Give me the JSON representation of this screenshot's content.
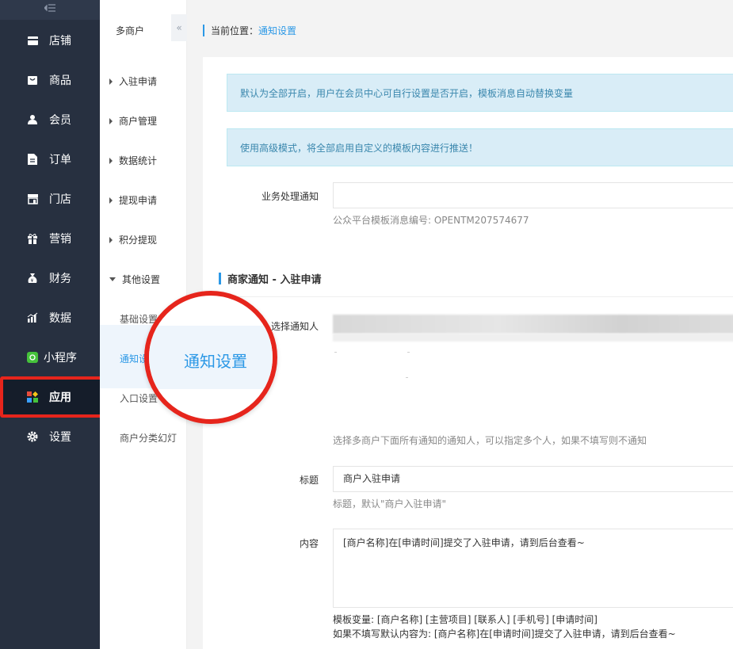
{
  "sidebar": {
    "collapse_icon": "menu-collapse-icon",
    "items": [
      {
        "label": "店铺",
        "icon": "store-icon"
      },
      {
        "label": "商品",
        "icon": "bag-icon"
      },
      {
        "label": "会员",
        "icon": "user-icon"
      },
      {
        "label": "订单",
        "icon": "document-icon"
      },
      {
        "label": "门店",
        "icon": "shop-icon"
      },
      {
        "label": "营销",
        "icon": "gift-icon"
      },
      {
        "label": "财务",
        "icon": "money-bag-icon"
      },
      {
        "label": "数据",
        "icon": "bar-chart-icon"
      },
      {
        "label": "小程序",
        "icon": "mini-program-icon"
      },
      {
        "label": "应用",
        "icon": "apps-icon"
      },
      {
        "label": "设置",
        "icon": "gear-icon"
      }
    ],
    "active": "应用"
  },
  "submenu": {
    "title": "多商户",
    "collapse": "«",
    "groups": [
      {
        "label": "入驻申请"
      },
      {
        "label": "商户管理"
      },
      {
        "label": "数据统计"
      },
      {
        "label": "提现申请"
      },
      {
        "label": "积分提现"
      },
      {
        "label": "其他设置"
      }
    ],
    "children": [
      {
        "label": "基础设置"
      },
      {
        "label": "通知设"
      },
      {
        "label": "入口设置"
      },
      {
        "label": "商户分类幻灯"
      }
    ]
  },
  "breadcrumb": {
    "prefix": "当前位置：",
    "current": "通知设置"
  },
  "notices": [
    "默认为全部开启，用户在会员中心可自行设置是否开启，模板消息自动替换变量",
    "使用高级模式，将全部启用自定义的模板内容进行推送！"
  ],
  "form": {
    "business_label": "业务处理通知",
    "business_value": "",
    "business_hint": "公众平台模板消息编号: OPENTM207574677",
    "section_title": "商家通知 - 入驻申请",
    "notify_label": "选择通知人",
    "notify_hint": "选择多商户下面所有通知的通知人，可以指定多个人，如果不填写则不通知",
    "title_label": "标题",
    "title_value": "商户入驻申请",
    "title_hint": "标题，默认\"商户入驻申请\"",
    "content_label": "内容",
    "content_value": "[商户名称]在[申请时间]提交了入驻申请，请到后台查看~",
    "vars_hint": "模板变量: [商户名称] [主营项目] [联系人] [手机号] [申请时间]",
    "default_hint": "如果不填写默认内容为: [商户名称]在[申请时间]提交了入驻申请，请到后台查看~"
  },
  "callout": {
    "text": "通知设置"
  },
  "colors": {
    "sidebar_bg": "#273040",
    "accent": "#2b98e6",
    "highlight": "#e6251c",
    "notice_bg": "#d9edf7"
  }
}
